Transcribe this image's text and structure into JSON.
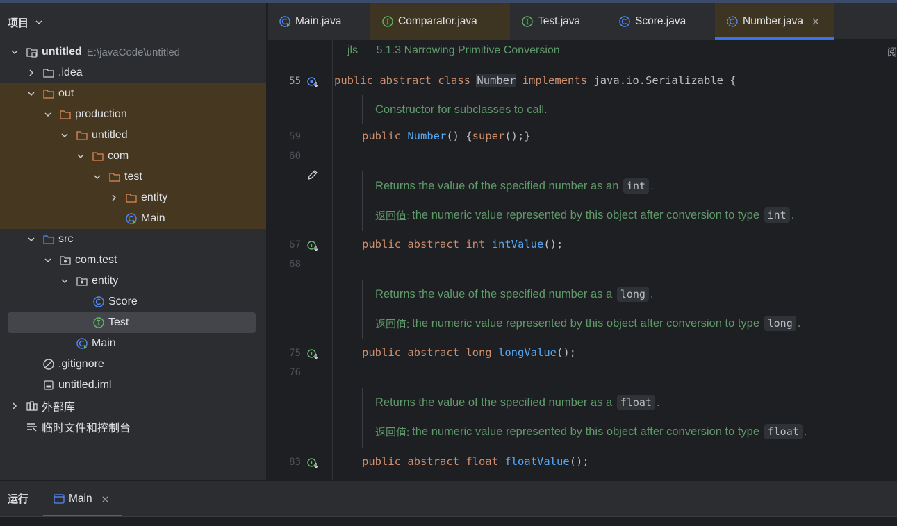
{
  "project_panel": {
    "title": "项目",
    "tree": [
      {
        "label": "untitled",
        "path": "E:\\javaCode\\untitled",
        "icon": "module-folder-icon"
      },
      {
        "label": ".idea",
        "icon": "folder-icon"
      },
      {
        "label": "out",
        "icon": "folder-icon"
      },
      {
        "label": "production",
        "icon": "folder-icon"
      },
      {
        "label": "untitled",
        "icon": "folder-icon"
      },
      {
        "label": "com",
        "icon": "folder-icon"
      },
      {
        "label": "test",
        "icon": "folder-icon"
      },
      {
        "label": "entity",
        "icon": "folder-icon"
      },
      {
        "label": "Main",
        "icon": "class-main-icon"
      },
      {
        "label": "src",
        "icon": "source-folder-icon"
      },
      {
        "label": "com.test",
        "icon": "package-icon"
      },
      {
        "label": "entity",
        "icon": "package-icon"
      },
      {
        "label": "Score",
        "icon": "class-icon"
      },
      {
        "label": "Test",
        "icon": "interface-icon"
      },
      {
        "label": "Main",
        "icon": "class-main-icon"
      },
      {
        "label": ".gitignore",
        "icon": "ignore-file-icon"
      },
      {
        "label": "untitled.iml",
        "icon": "iml-file-icon"
      },
      {
        "label": "外部库",
        "icon": "library-icon"
      },
      {
        "label": "临时文件和控制台",
        "icon": "scratches-icon"
      }
    ]
  },
  "tabs": [
    {
      "label": "Main.java"
    },
    {
      "label": "Comparator.java"
    },
    {
      "label": "Test.java"
    },
    {
      "label": "Score.java"
    },
    {
      "label": "Number.java"
    }
  ],
  "editor": {
    "jls_tag": "jls",
    "jls_ref": "5.1.3 Narrowing Primitive Conversion",
    "right_edge_text": "阅",
    "class_decl": {
      "line": "55",
      "kw1": "public",
      "kw2": "abstract",
      "kw3": "class",
      "name": "Number",
      "kw4": "implements",
      "rest": "java.io.Serializable {"
    },
    "ctor_doc": "Constructor for subclasses to call.",
    "ctor": {
      "line": "59",
      "kw": "public",
      "name": "Number",
      "rest1": "() {",
      "kw2": "super",
      "rest2": "();}"
    },
    "blank_line_60": "60",
    "blank_line_68": "68",
    "blank_line_76": "76",
    "returns_label": "返回值:",
    "methods": [
      {
        "doc_prefix": "Returns the value of the specified number as an",
        "type": "int",
        "returns_text": "the numeric value represented by this object after conversion to type",
        "line": "67",
        "kw1": "public",
        "kw2": "abstract",
        "name": "intValue",
        "tail": "();"
      },
      {
        "doc_prefix": "Returns the value of the specified number as a",
        "type": "long",
        "returns_text": "the numeric value represented by this object after conversion to type",
        "line": "75",
        "kw1": "public",
        "kw2": "abstract",
        "name": "longValue",
        "tail": "();"
      },
      {
        "doc_prefix": "Returns the value of the specified number as a",
        "type": "float",
        "returns_text": "the numeric value represented by this object after conversion to type",
        "line": "83",
        "kw1": "public",
        "kw2": "abstract",
        "name": "floatValue",
        "tail": "();"
      }
    ]
  },
  "run_panel": {
    "label": "运行",
    "tab": "Main"
  },
  "colors": {
    "keyword": "#cf8e6d",
    "method": "#56a8f5",
    "doc": "#5f9a6a",
    "accent": "#3574f0",
    "out_folder_bg": "#453720"
  }
}
